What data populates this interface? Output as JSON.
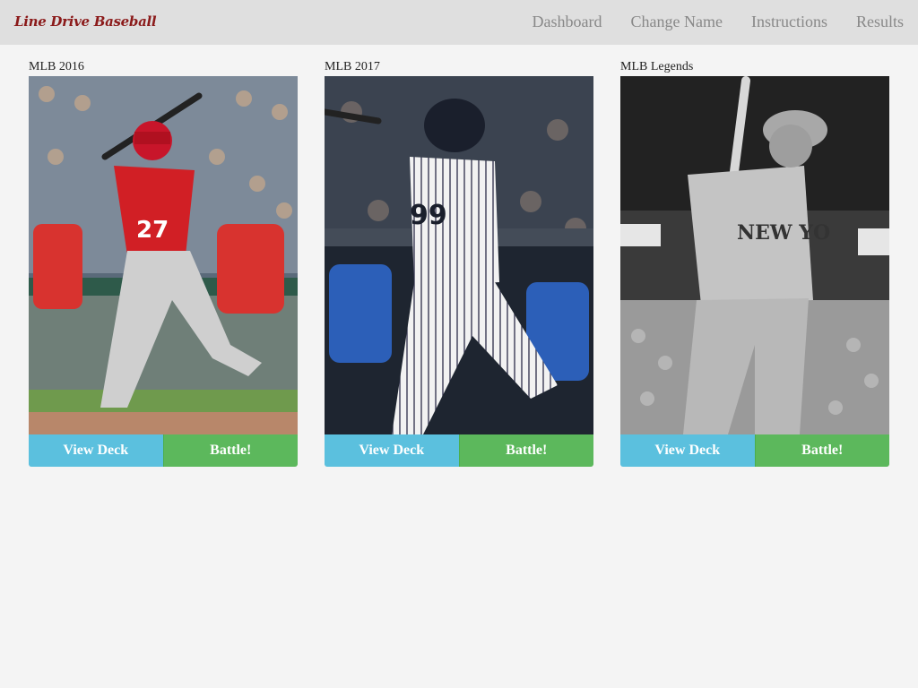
{
  "nav": {
    "brand": "Line Drive Baseball",
    "links": [
      "Dashboard",
      "Change Name",
      "Instructions",
      "Results"
    ]
  },
  "decks": [
    {
      "title": "MLB 2016",
      "photo_icon": "batter-red-uniform",
      "view_label": "View Deck",
      "battle_label": "Battle!"
    },
    {
      "title": "MLB 2017",
      "photo_icon": "batter-pinstripe-uniform",
      "view_label": "View Deck",
      "battle_label": "Battle!"
    },
    {
      "title": "MLB Legends",
      "photo_icon": "batter-vintage-bw",
      "view_label": "View Deck",
      "battle_label": "Battle!"
    }
  ],
  "colors": {
    "navbar": "#dfdfdf",
    "brand": "#8b1a1a",
    "view_button": "#5bc0de",
    "battle_button": "#5cb85c",
    "background": "#f4f4f4"
  }
}
